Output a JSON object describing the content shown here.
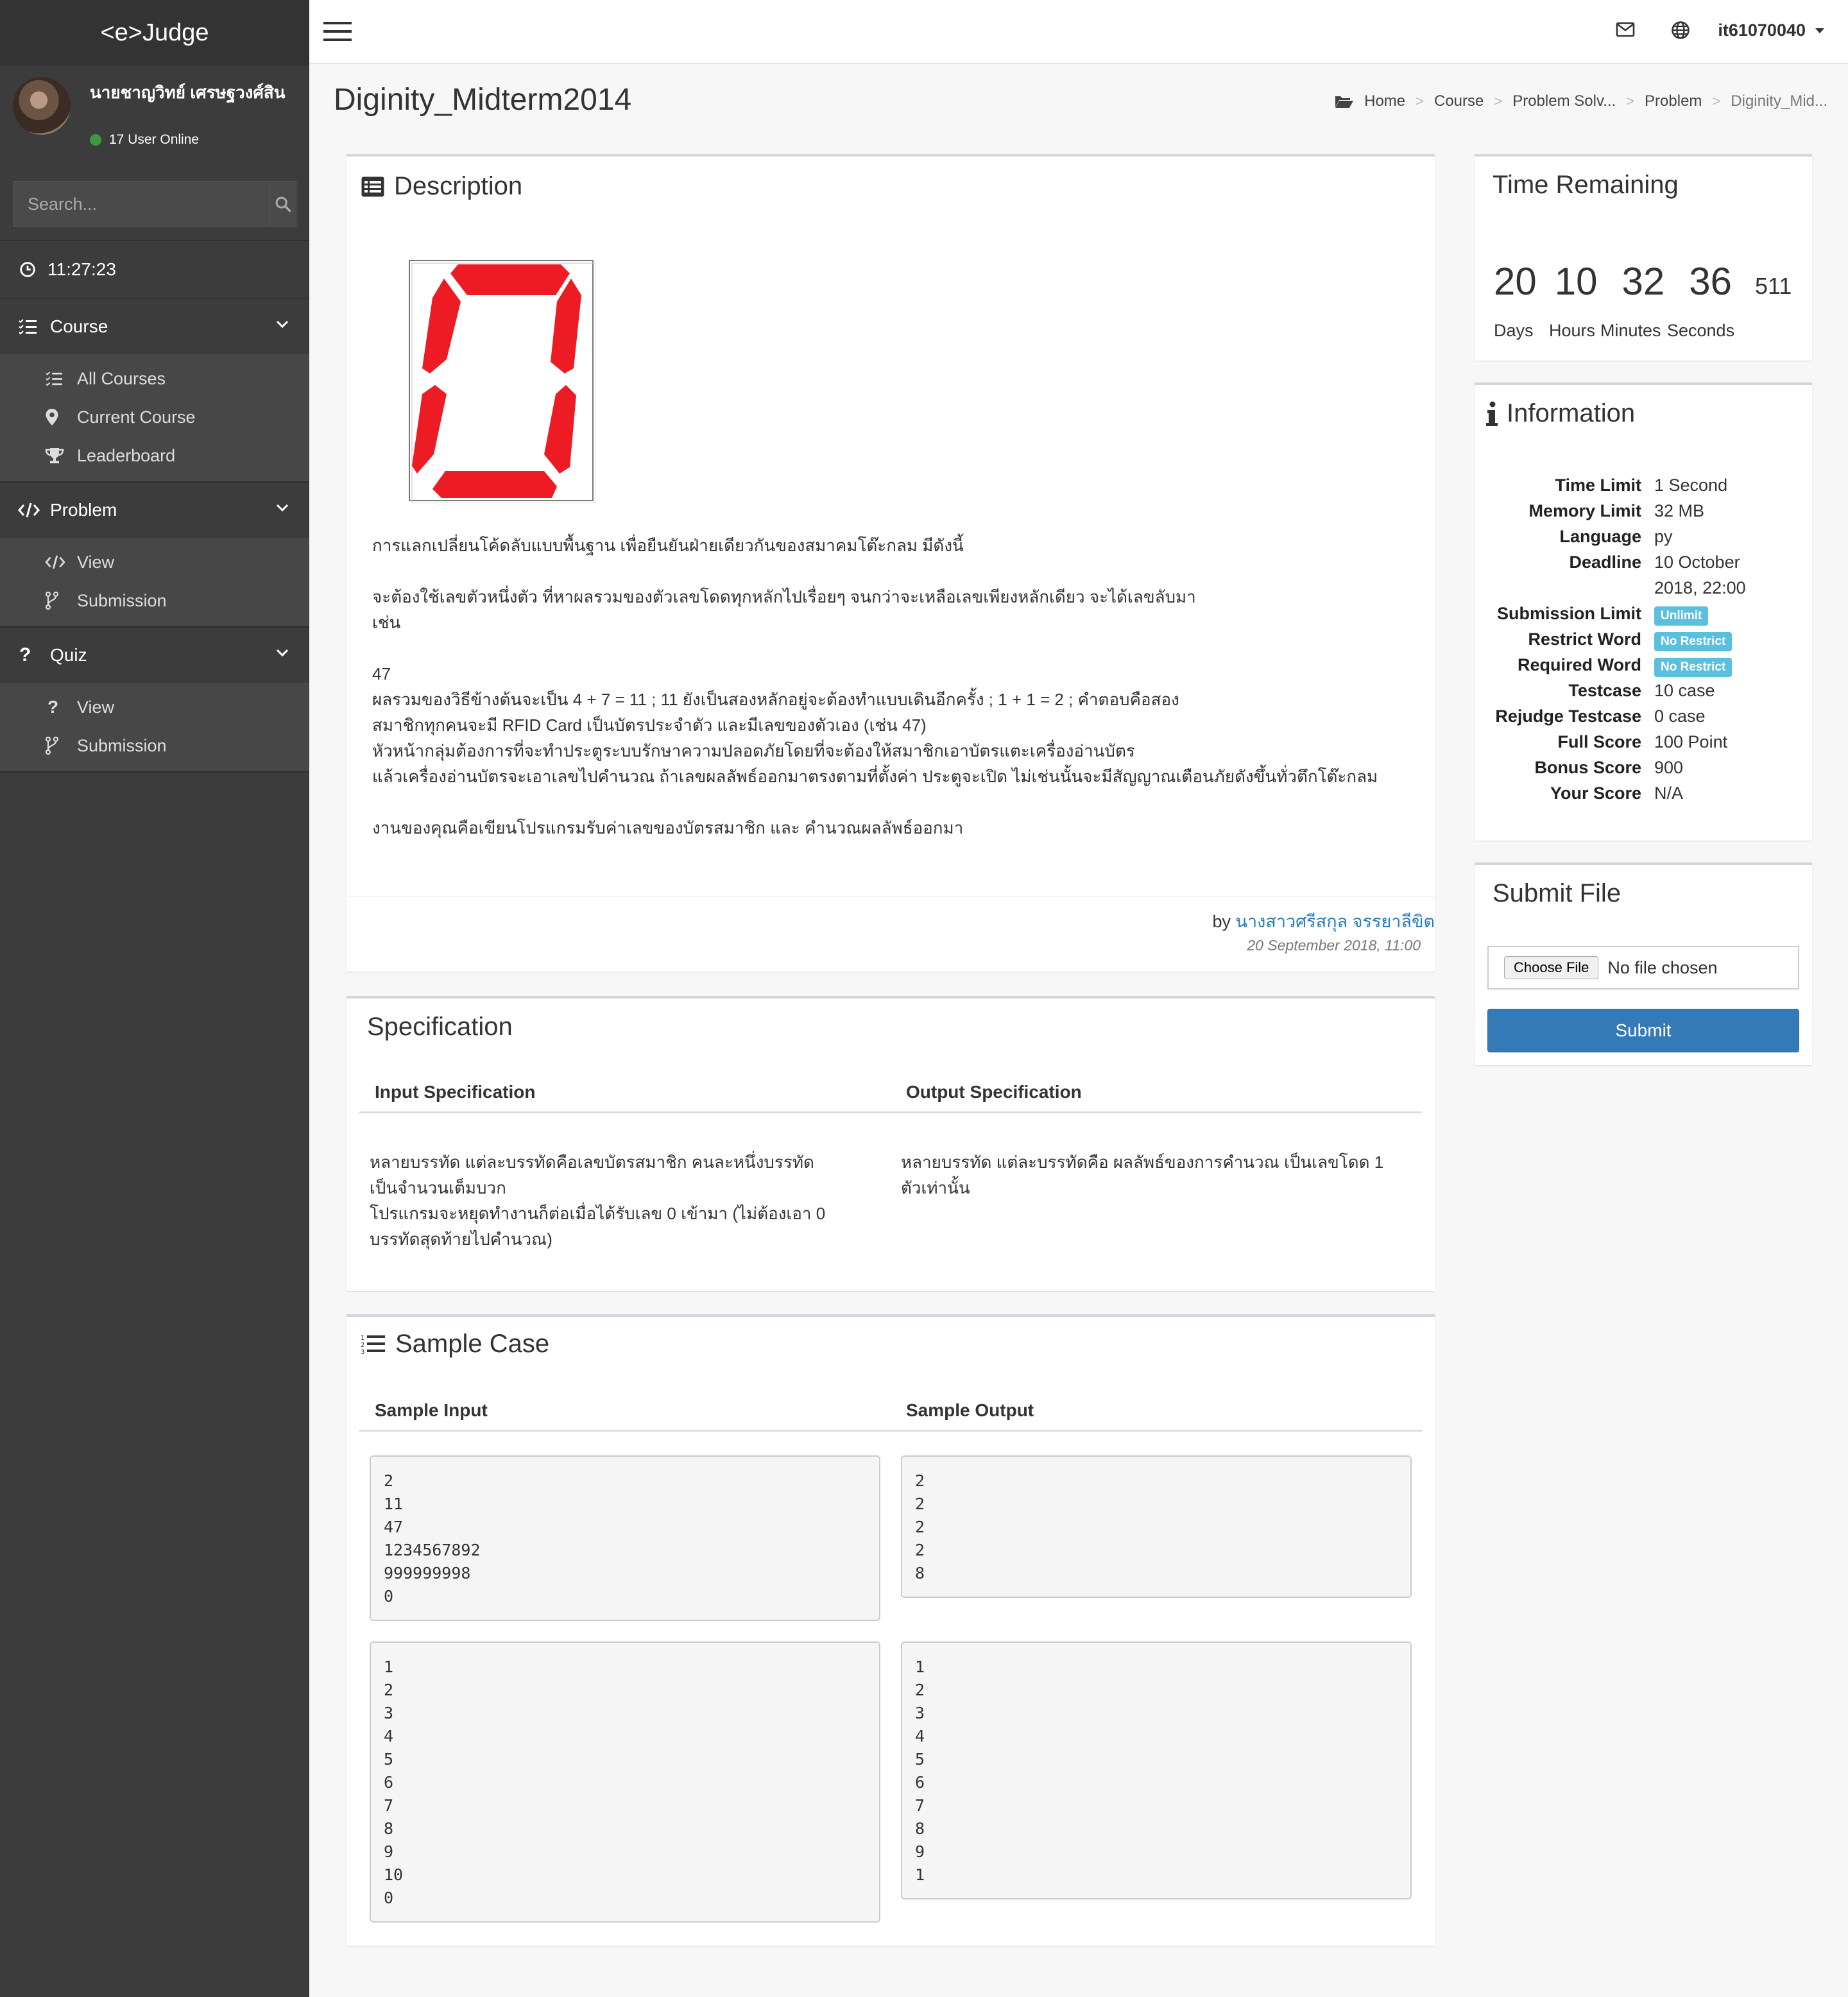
{
  "app": {
    "logo": "<e>Judge"
  },
  "user": {
    "name": "นายชาญวิทย์ เศรษฐวงศ์สิน",
    "online": "17 User Online"
  },
  "search": {
    "placeholder": "Search..."
  },
  "clock": "11:27:23",
  "sidebar": {
    "course": {
      "label": "Course",
      "items": [
        "All Courses",
        "Current Course",
        "Leaderboard"
      ]
    },
    "problem": {
      "label": "Problem",
      "items": [
        "View",
        "Submission"
      ]
    },
    "quiz": {
      "label": "Quiz",
      "items": [
        "View",
        "Submission"
      ]
    }
  },
  "topbar": {
    "username": "it61070040"
  },
  "page": {
    "title": "Diginity_Midterm2014"
  },
  "breadcrumb": [
    "Home",
    "Course",
    "Problem Solv...",
    "Problem",
    "Diginity_Mid..."
  ],
  "description": {
    "title": "Description",
    "paragraphs": [
      "การแลกเปลี่ยนโค้ดลับแบบพื้นฐาน เพื่อยืนยันฝ่ายเดียวกันของสมาคมโต๊ะกลม มีดังนี้",
      "",
      "จะต้องใช้เลขตัวหนึ่งตัว ที่หาผลรวมของตัวเลขโดดทุกหลักไปเรื่อยๆ จนกว่าจะเหลือเลขเพียงหลักเดียว จะได้เลขลับมา",
      "เช่น",
      "",
      "47",
      "ผลรวมของวิธีข้างต้นจะเป็น 4 + 7 = 11 ; 11 ยังเป็นสองหลักอยู่จะต้องทำแบบเดินอีกครั้ง ; 1 + 1 = 2 ; คำตอบคือสอง",
      "สมาชิกทุกคนจะมี RFID Card เป็นบัตรประจำตัว และมีเลขของตัวเอง (เช่น 47)",
      "หัวหน้ากลุ่มต้องการที่จะทำประตูระบบรักษาความปลอดภัยโดยที่จะต้องให้สมาชิกเอาบัตรแตะเครื่องอ่านบัตร",
      "แล้วเครื่องอ่านบัตรจะเอาเลขไปคำนวณ ถ้าเลขผลลัพธ์ออกมาตรงตามที่ตั้งค่า ประตูจะเปิด ไม่เช่นนั้นจะมีสัญญาณเตือนภัยดังขึ้นทั่วตึกโต๊ะกลม",
      "",
      "งานของคุณคือเขียนโปรแกรมรับค่าเลขของบัตรสมาชิก และ คำนวณผลลัพธ์ออกมา"
    ],
    "by_prefix": "by",
    "author": "นางสาวศรีสกุล จรรยาลีขิต",
    "date": "20 September 2018, 11:00"
  },
  "specification": {
    "title": "Specification",
    "input_header": "Input Specification",
    "output_header": "Output Specification",
    "input_text": "หลายบรรทัด แต่ละบรรทัดคือเลขบัตรสมาชิก คนละหนึ่งบรรทัดเป็นจำนวนเต็มบวก\nโปรแกรมจะหยุดทำงานก็ต่อเมื่อได้รับเลข 0 เข้ามา (ไม่ต้องเอา 0 บรรทัดสุดท้ายไปคำนวณ)",
    "output_text": "หลายบรรทัด แต่ละบรรทัดคือ ผลลัพธ์ของการคำนวณ เป็นเลขโดด 1 ตัวเท่านั้น"
  },
  "samples": {
    "title": "Sample Case",
    "input_header": "Sample Input",
    "output_header": "Sample Output",
    "cases": [
      {
        "input": "2\n11\n47\n1234567892\n999999998\n0",
        "output": "2\n2\n2\n2\n8"
      },
      {
        "input": "1\n2\n3\n4\n5\n6\n7\n8\n9\n10\n0",
        "output": "1\n2\n3\n4\n5\n6\n7\n8\n9\n1"
      }
    ]
  },
  "time_remaining": {
    "title": "Time Remaining",
    "days": "20",
    "hours": "10",
    "minutes": "32",
    "seconds": "36",
    "ms": "511",
    "labels": {
      "days": "Days",
      "hours": "Hours",
      "minutes": "Minutes",
      "seconds": "Seconds"
    }
  },
  "information": {
    "title": "Information",
    "rows": [
      {
        "key": "Time Limit",
        "value": "1 Second"
      },
      {
        "key": "Memory Limit",
        "value": "32 MB"
      },
      {
        "key": "Language",
        "value": "py"
      },
      {
        "key": "Deadline",
        "value": "10 October 2018, 22:00"
      },
      {
        "key": "Submission Limit",
        "badge": "Unlimit"
      },
      {
        "key": "Restrict Word",
        "badge": "No Restrict"
      },
      {
        "key": "Required Word",
        "badge": "No Restrict"
      },
      {
        "key": "Testcase",
        "value": "10 case"
      },
      {
        "key": "Rejudge Testcase",
        "value": "0 case"
      },
      {
        "key": "Full Score",
        "value": "100 Point"
      },
      {
        "key": "Bonus Score",
        "value": "900"
      },
      {
        "key": "Your Score",
        "value": "N/A"
      }
    ]
  },
  "submit": {
    "title": "Submit File",
    "choose_label": "Choose File",
    "no_file": "No file chosen",
    "button": "Submit"
  },
  "colors": {
    "sidebar": "#3c3c3c",
    "accent": "#337ab7",
    "badge": "#5bc0de",
    "link": "#2a7bbd",
    "segment_red": "#ed1c24"
  }
}
